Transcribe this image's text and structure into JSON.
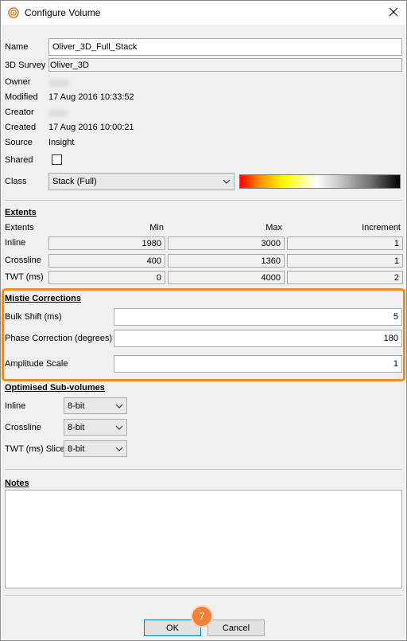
{
  "window": {
    "title": "Configure Volume"
  },
  "general": {
    "name_label": "Name",
    "name_value": "Oliver_3D_Full_Stack",
    "survey_label": "3D Survey",
    "survey_value": "Oliver_3D",
    "owner_label": "Owner",
    "modified_label": "Modified",
    "modified_value": "17 Aug 2016 10:33:52",
    "creator_label": "Creator",
    "created_label": "Created",
    "created_value": "17 Aug 2016 10:00:21",
    "source_label": "Source",
    "source_value": "Insight",
    "shared_label": "Shared",
    "class_label": "Class",
    "class_value": "Stack (Full)"
  },
  "extents": {
    "heading": "Extents",
    "col_label": "Extents",
    "col_min": "Min",
    "col_max": "Max",
    "col_increment": "Increment",
    "rows": [
      {
        "label": "Inline",
        "min": "1980",
        "max": "3000",
        "inc": "1"
      },
      {
        "label": "Crossline",
        "min": "400",
        "max": "1360",
        "inc": "1"
      },
      {
        "label": "TWT (ms)",
        "min": "0",
        "max": "4000",
        "inc": "2"
      }
    ]
  },
  "mistie": {
    "heading": "Mistie Corrections",
    "bulk_label": "Bulk Shift (ms)",
    "bulk_value": "5",
    "phase_label": "Phase Correction (degrees)",
    "phase_value": "180",
    "amp_label": "Amplitude Scale",
    "amp_value": "1"
  },
  "subvolumes": {
    "heading": "Optimised Sub-volumes",
    "rows": [
      {
        "label": "Inline",
        "value": "8-bit"
      },
      {
        "label": "Crossline",
        "value": "8-bit"
      },
      {
        "label": "TWT (ms) Slice",
        "value": "8-bit"
      }
    ]
  },
  "notes": {
    "heading": "Notes"
  },
  "buttons": {
    "ok": "OK",
    "cancel": "Cancel"
  },
  "callout": {
    "number": "7"
  },
  "colors": {
    "highlight": "#f08a24",
    "callout": "#f07f38",
    "default_button_border": "#0078d7"
  },
  "icons": {
    "app": "volume-icon",
    "close": "close-icon",
    "dropdown": "chevron-down-icon"
  }
}
